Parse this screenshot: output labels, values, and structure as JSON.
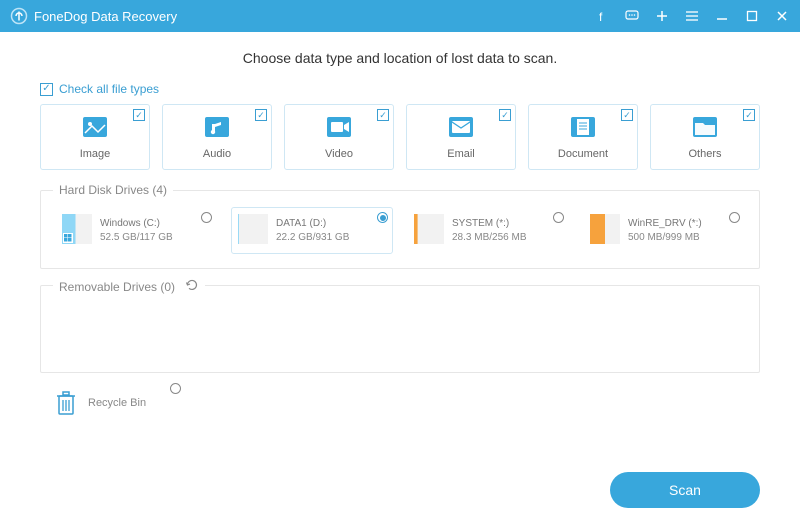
{
  "titlebar": {
    "app_name": "FoneDog Data Recovery"
  },
  "heading": "Choose data type and location of lost data to scan.",
  "check_all_label": "Check all file types",
  "types": [
    {
      "label": "Image",
      "icon": "image"
    },
    {
      "label": "Audio",
      "icon": "audio"
    },
    {
      "label": "Video",
      "icon": "video"
    },
    {
      "label": "Email",
      "icon": "email"
    },
    {
      "label": "Document",
      "icon": "document"
    },
    {
      "label": "Others",
      "icon": "others"
    }
  ],
  "hard_disk": {
    "legend": "Hard Disk Drives (4)",
    "drives": [
      {
        "name": "Windows (C:)",
        "size": "52.5 GB/117 GB",
        "color": "#8fd7f6",
        "fill": 0.45,
        "win": true
      },
      {
        "name": "DATA1 (D:)",
        "size": "22.2 GB/931 GB",
        "color": "#8fd7f6",
        "fill": 0.03,
        "selected": true
      },
      {
        "name": "SYSTEM (*:)",
        "size": "28.3 MB/256 MB",
        "color": "#f6a23d",
        "fill": 0.12
      },
      {
        "name": "WinRE_DRV (*:)",
        "size": "500 MB/999 MB",
        "color": "#f6a23d",
        "fill": 0.5
      }
    ]
  },
  "removable": {
    "legend": "Removable Drives (0)"
  },
  "recycle_bin_label": "Recycle Bin",
  "scan_label": "Scan"
}
